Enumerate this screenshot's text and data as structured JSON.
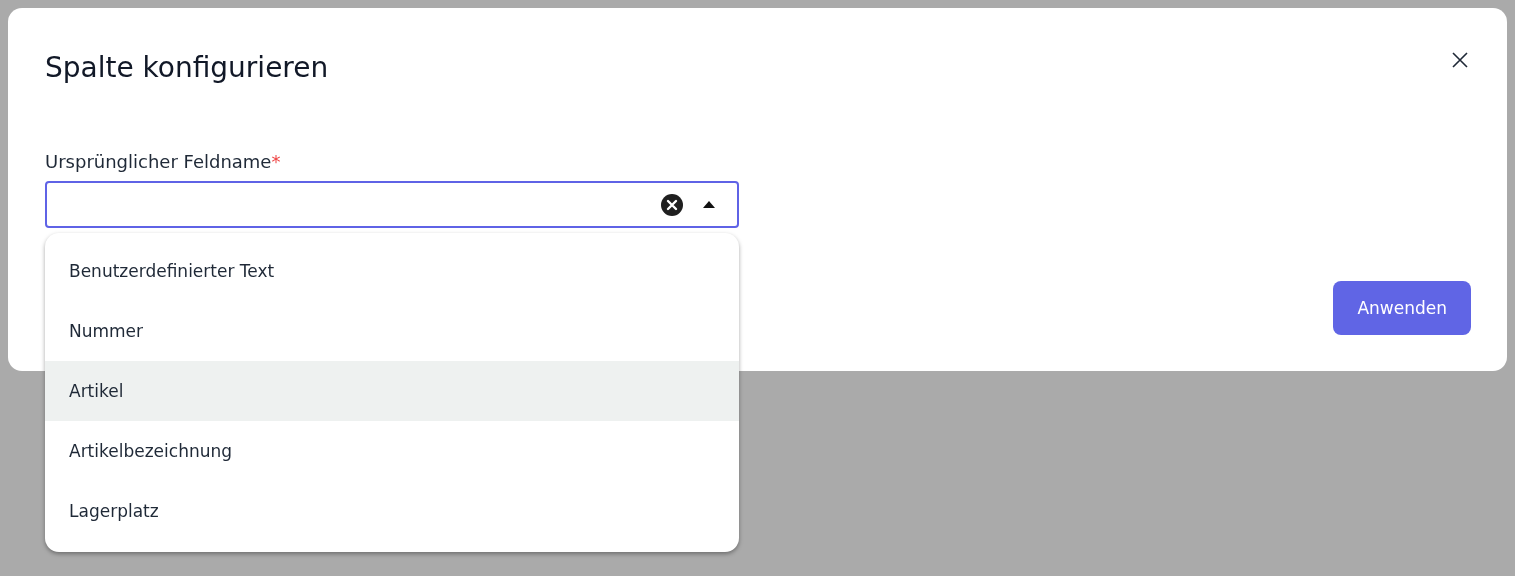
{
  "dialog": {
    "title": "Spalte konfigurieren"
  },
  "field": {
    "label": "Ursprünglicher Feldname",
    "required_mark": "*",
    "focused": true,
    "open": true
  },
  "options": [
    {
      "label": "Benutzerdefinierter Text",
      "selected": false
    },
    {
      "label": "Nummer",
      "selected": false
    },
    {
      "label": "Artikel",
      "selected": true
    },
    {
      "label": "Artikelbezeichnung",
      "selected": false
    },
    {
      "label": "Lagerplatz",
      "selected": false
    }
  ],
  "buttons": [
    {
      "label": "Anwenden"
    }
  ]
}
